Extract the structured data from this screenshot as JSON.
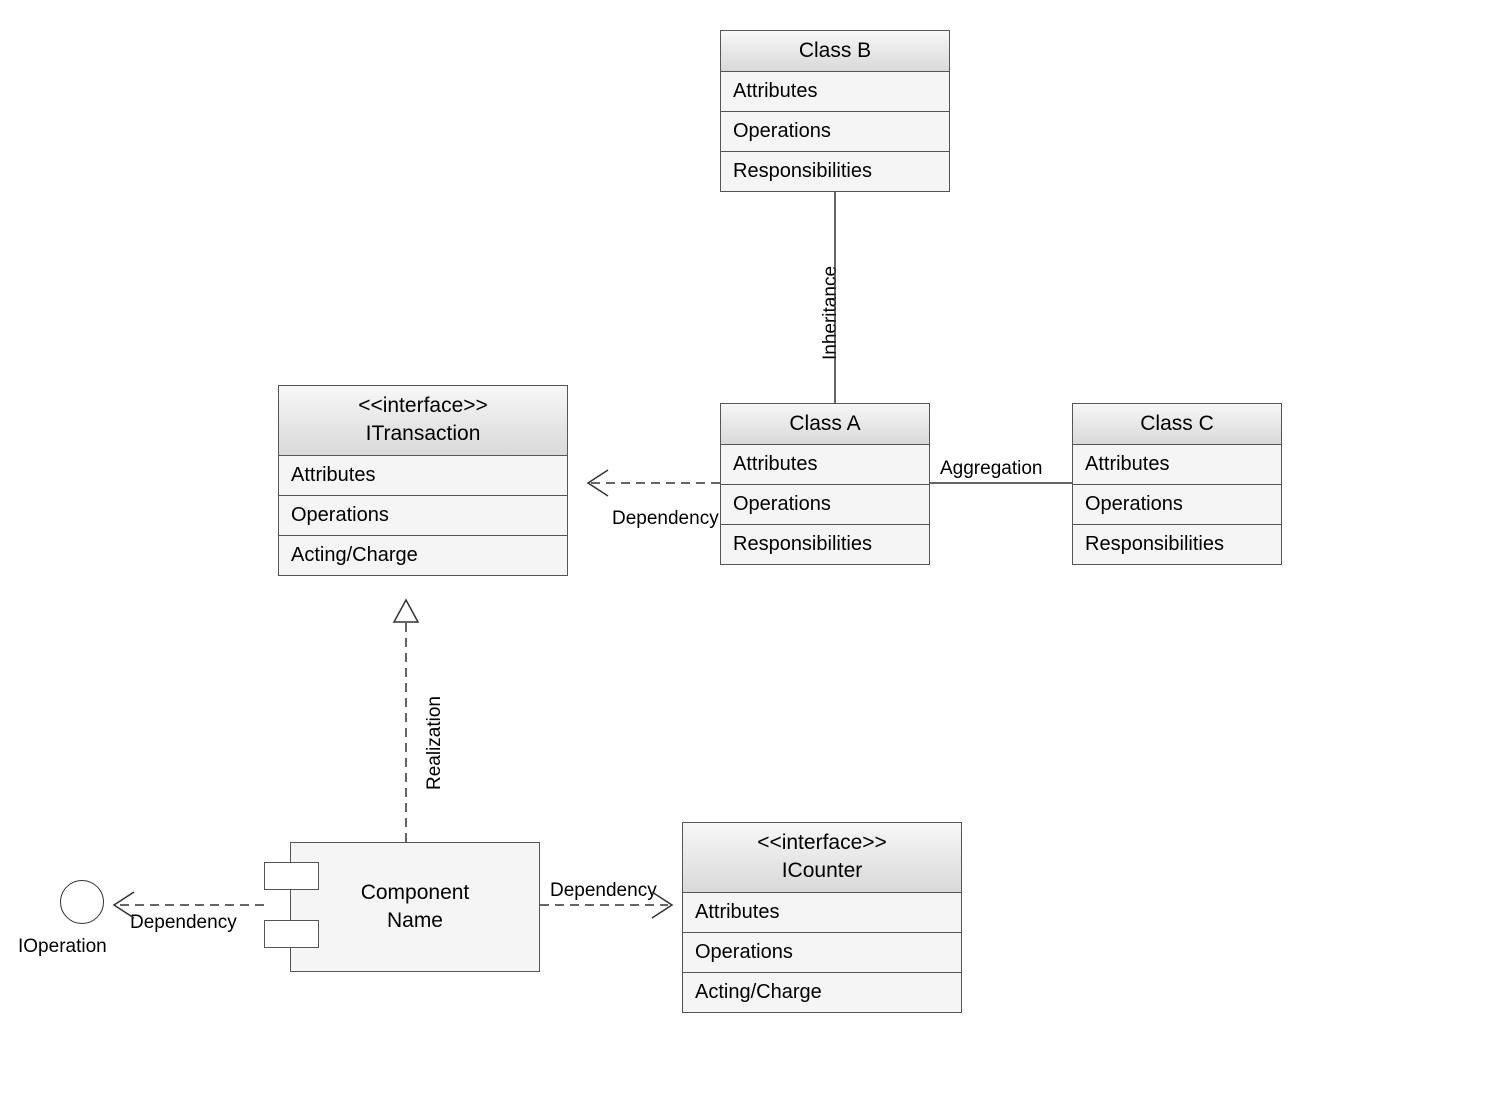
{
  "classes": {
    "classB": {
      "name": "Class B",
      "attrs": "Attributes",
      "ops": "Operations",
      "resp": "Responsibilities"
    },
    "classA": {
      "name": "Class A",
      "attrs": "Attributes",
      "ops": "Operations",
      "resp": "Responsibilities"
    },
    "classC": {
      "name": "Class C",
      "attrs": "Attributes",
      "ops": "Operations",
      "resp": "Responsibilities"
    },
    "itransaction": {
      "stereo": "<<interface>>",
      "name": "ITransaction",
      "attrs": "Attributes",
      "ops": "Operations",
      "third": "Acting/Charge"
    },
    "icounter": {
      "stereo": "<<interface>>",
      "name": "ICounter",
      "attrs": "Attributes",
      "ops": "Operations",
      "third": "Acting/Charge"
    }
  },
  "component": {
    "label": "Component\nName"
  },
  "interfaceBall": {
    "label": "IOperation"
  },
  "relations": {
    "inheritance": "Inheritance",
    "aggregation": "Aggregation",
    "dependency1": "Dependency",
    "dependency2": "Dependency",
    "dependency3": "Dependency",
    "realization": "Realization"
  }
}
